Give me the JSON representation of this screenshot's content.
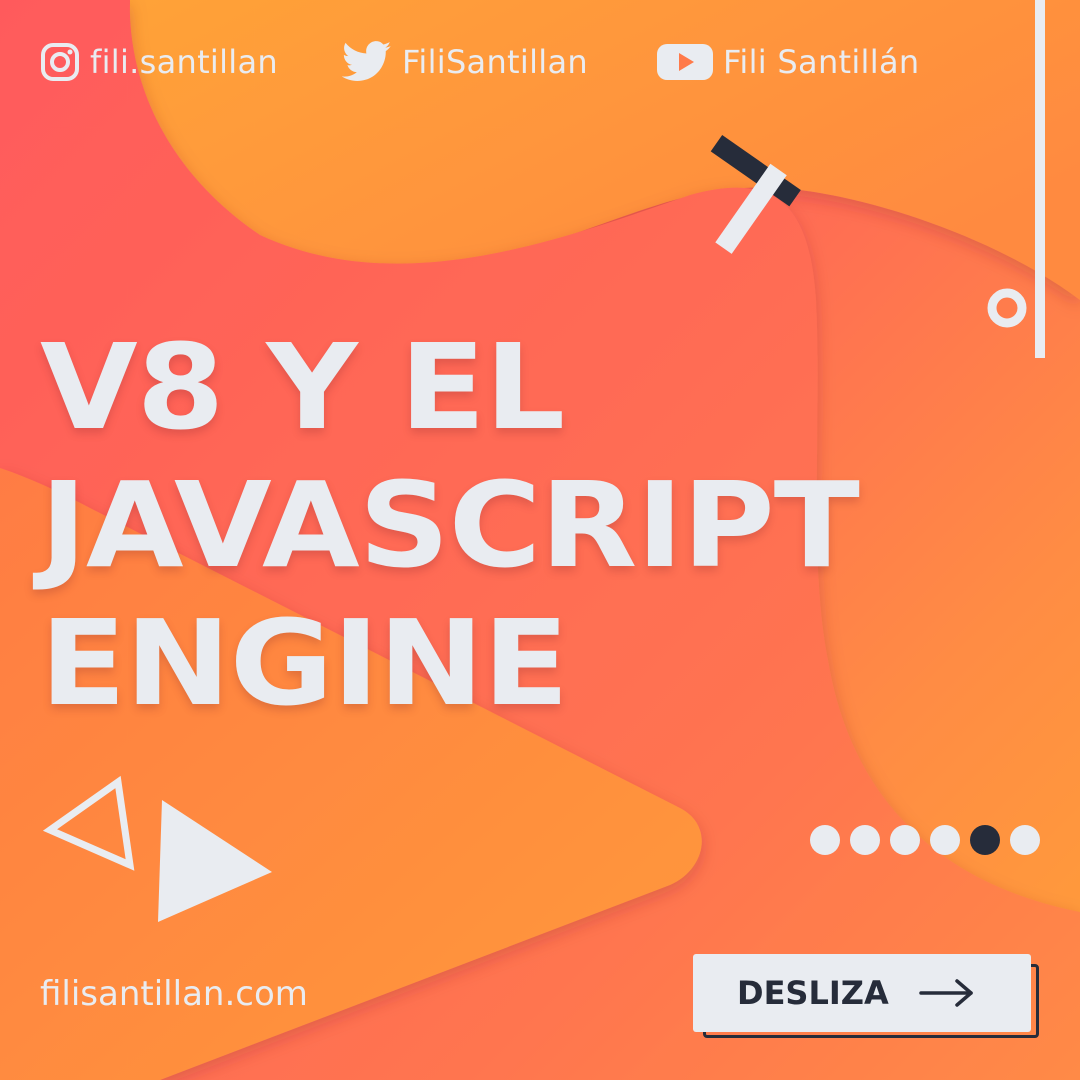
{
  "social": {
    "instagram": {
      "icon": "instagram-icon",
      "handle": "fili.santillan"
    },
    "twitter": {
      "icon": "twitter-bird-icon",
      "handle": "FiliSantillan"
    },
    "youtube": {
      "icon": "youtube-play-icon",
      "handle": "Fili Santillán"
    }
  },
  "headline": {
    "lines": [
      "V8 Y EL",
      "JAVASCRIPT",
      "ENGINE"
    ]
  },
  "footer": {
    "website": "filisantillan.com",
    "cta_label": "DESLIZA",
    "cta_icon": "arrow-right-icon"
  },
  "pagination": {
    "total": 6,
    "current": 5
  },
  "colors": {
    "gradient_pink": "#ff4f63",
    "gradient_orange": "#ff9f38",
    "light": "#e9ecf1",
    "dark": "#262c3a"
  }
}
